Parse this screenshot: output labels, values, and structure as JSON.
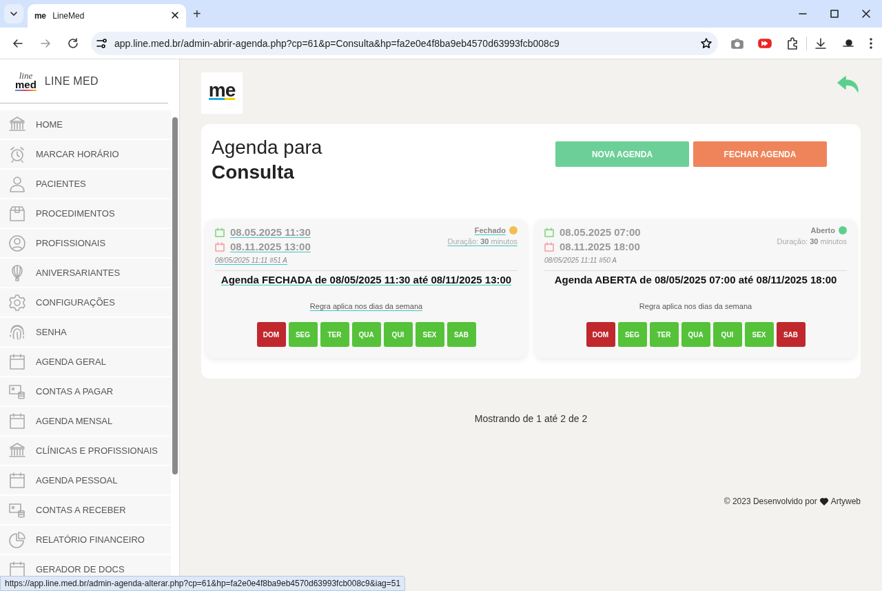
{
  "browser": {
    "tab": {
      "title": "LineMed",
      "favicon": "me"
    },
    "new_tab": "+",
    "address": "app.line.med.br/admin-abrir-agenda.php?cp=61&p=Consulta&hp=fa2e0e4f8ba9eb4570d63993fcb008c9"
  },
  "sidebar": {
    "logo_top": "line",
    "logo_bottom": "med",
    "brand": "LINE MED",
    "items": [
      {
        "label": "HOME"
      },
      {
        "label": "MARCAR HORÁRIO"
      },
      {
        "label": "PACIENTES"
      },
      {
        "label": "PROCEDIMENTOS"
      },
      {
        "label": "PROFISSIONAIS"
      },
      {
        "label": "ANIVERSARIANTES"
      },
      {
        "label": "CONFIGURAÇÕES"
      },
      {
        "label": "SENHA"
      },
      {
        "label": "AGENDA GERAL"
      },
      {
        "label": "CONTAS A PAGAR"
      },
      {
        "label": "AGENDA MENSAL"
      },
      {
        "label": "CLÍNICAS E PROFISSIONAIS"
      },
      {
        "label": "AGENDA PESSOAL"
      },
      {
        "label": "CONTAS A RECEBER"
      },
      {
        "label": "RELATÓRIO FINANCEIRO"
      },
      {
        "label": "GERADOR DE DOCS"
      }
    ]
  },
  "header": {
    "logo": "me"
  },
  "panel": {
    "title": "Agenda para",
    "subject": "Consulta",
    "buttons": [
      {
        "label": "NOVA AGENDA",
        "kind": "primary"
      },
      {
        "label": "FECHAR AGENDA",
        "kind": "danger"
      }
    ]
  },
  "agendas": [
    {
      "hovered": true,
      "start": "08.05.2025 11:30",
      "end": "08.11.2025 13:00",
      "status": "Fechado",
      "color": "#f5bd4f",
      "duration_label": "Duração:",
      "duration_value": "30",
      "duration_unit": "minutos",
      "created": "08/05/2025 11:11 #51 A",
      "summary": "Agenda FECHADA de 08/05/2025 11:30 até 08/11/2025 13:00",
      "rule": "Regra aplica nos dias da semana",
      "days": [
        {
          "label": "DOM",
          "on": false
        },
        {
          "label": "SEG",
          "on": true
        },
        {
          "label": "TER",
          "on": true
        },
        {
          "label": "QUA",
          "on": true
        },
        {
          "label": "QUI",
          "on": true
        },
        {
          "label": "SEX",
          "on": true
        },
        {
          "label": "SAB",
          "on": true
        }
      ]
    },
    {
      "hovered": false,
      "start": "08.05.2025 07:00",
      "end": "08.11.2025 18:00",
      "status": "Aberto",
      "color": "#5ccf8f",
      "duration_label": "Duração:",
      "duration_value": "30",
      "duration_unit": "minutos",
      "created": "08/05/2025 11:11 #50 A",
      "summary": "Agenda ABERTA de 08/05/2025 07:00 até 08/11/2025 18:00",
      "rule": "Regra aplica nos dias da semana",
      "days": [
        {
          "label": "DOM",
          "on": false
        },
        {
          "label": "SEG",
          "on": true
        },
        {
          "label": "TER",
          "on": true
        },
        {
          "label": "QUA",
          "on": true
        },
        {
          "label": "QUI",
          "on": true
        },
        {
          "label": "SEX",
          "on": true
        },
        {
          "label": "SAB",
          "on": false
        }
      ]
    }
  ],
  "pagination": "Mostrando de 1 até 2 de 2",
  "footer": {
    "prefix": "© 2023 Desenvolvido por",
    "author": "Artyweb"
  },
  "status_url": "https://app.line.med.br/admin-agenda-alterar.php?cp=61&hp=fa2e0e4f8ba9eb4570d63993fcb008c9&iag=51"
}
